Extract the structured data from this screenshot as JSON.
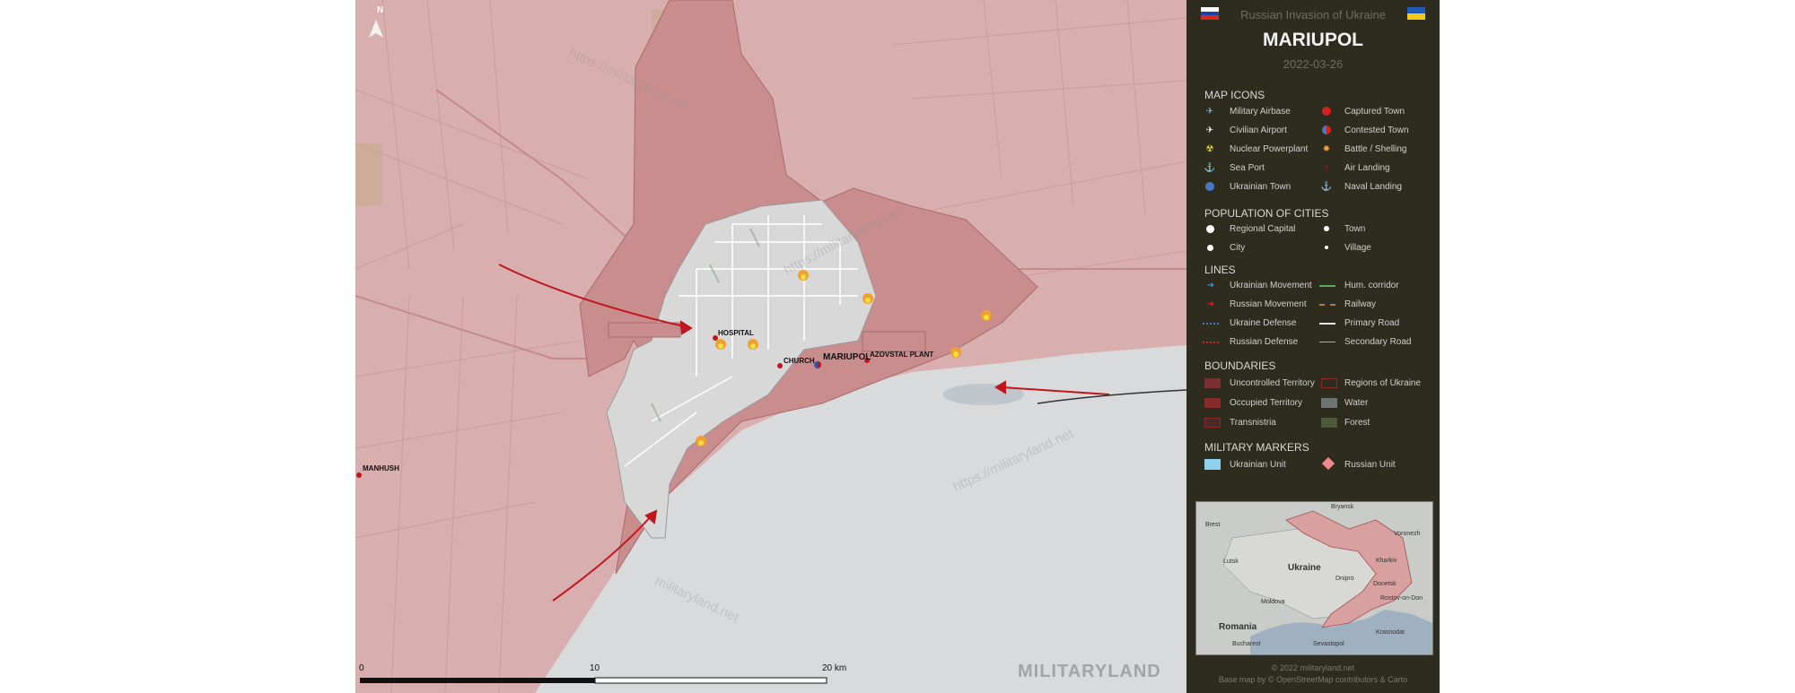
{
  "header": {
    "subtitle": "Russian Invasion of Ukraine",
    "title": "MARIUPOL",
    "date": "2022-03-26"
  },
  "legend": {
    "map_icons": {
      "heading": "MAP ICONS",
      "left": [
        "Military Airbase",
        "Civilian Airport",
        "Nuclear Powerplant",
        "Sea Port",
        "Ukrainian Town"
      ],
      "right": [
        "Captured Town",
        "Contested Town",
        "Battle / Shelling",
        "Air Landing",
        "Naval Landing"
      ]
    },
    "population": {
      "heading": "POPULATION OF CITIES",
      "items": [
        "Regional Capital",
        "Town",
        "City",
        "Village"
      ]
    },
    "lines": {
      "heading": "LINES",
      "left": [
        "Ukrainian Movement",
        "Russian Movement",
        "Ukraine Defense",
        "Russian Defense"
      ],
      "right": [
        "Hum. corridor",
        "Railway",
        "Primary Road",
        "Secondary Road"
      ]
    },
    "boundaries": {
      "heading": "BOUNDARIES",
      "left": [
        "Uncontrolled Territory",
        "Occupied Territory",
        "Transnistria"
      ],
      "right": [
        "Regions of Ukraine",
        "Water",
        "Forest"
      ]
    },
    "military_markers": {
      "heading": "MILITARY MARKERS",
      "items": [
        "Ukrainian Unit",
        "Russian Unit"
      ]
    }
  },
  "inset_map": {
    "labels": [
      "Bryansk",
      "Brest",
      "Voronezh",
      "Lutsk",
      "Kharkiv",
      "Ukraine",
      "Dnipro",
      "Donetsk",
      "Rostov-on-Don",
      "Moldova",
      "Romania",
      "Krasnodar",
      "Bucharest",
      "Sevastopol"
    ]
  },
  "map": {
    "north": "N",
    "places": {
      "mariupol": "MARIUPOL",
      "hospital": "HOSPITAL",
      "church": "CHURCH",
      "azovstal": "AZOVSTAL PLANT",
      "manhush": "MANHUSH"
    },
    "watermarks": [
      "https://militaryland.net",
      "https://militaryland.net",
      "https://militaryland.net",
      "militaryland.net"
    ],
    "scale": {
      "labels": [
        "0",
        "10",
        "20 km"
      ]
    },
    "brand": "MILITARYLAND"
  },
  "footer": {
    "copyright": "© 2022 militaryland.net",
    "attribution": "Base map by © OpenStreetMap contributors & Carto"
  },
  "colors": {
    "occupied": "#d9aeae",
    "uncontrolled": "#c98d8d",
    "city": "#d8d8d8",
    "sea": "#d8dadc",
    "panel": "#2e2c1f",
    "russian_arrow": "#c0161e"
  }
}
